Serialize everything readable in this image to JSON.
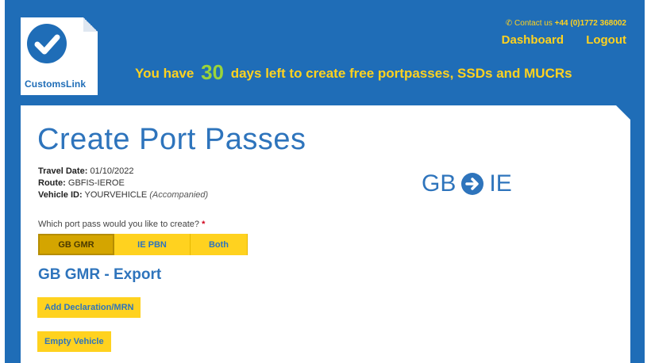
{
  "header": {
    "logo_text": "CustomsLink",
    "contact_prefix": "Contact us",
    "contact_phone": "+44 (0)1772 368002",
    "nav": {
      "dashboard": "Dashboard",
      "logout": "Logout"
    },
    "trial_before": "You have",
    "trial_days": "30",
    "trial_after": "days left to create free portpasses, SSDs and MUCRs"
  },
  "page": {
    "title": "Create Port Passes",
    "travel_date_label": "Travel Date:",
    "travel_date": "01/10/2022",
    "route_label": "Route:",
    "route": "GBFIS-IEROE",
    "vehicle_label": "Vehicle ID:",
    "vehicle_id": "YOURVEHICLE",
    "vehicle_type": "(Accompanied)",
    "route_from": "GB",
    "route_to": "IE",
    "question": "Which port pass would you like to create?",
    "required_mark": "*",
    "tabs": [
      "GB GMR",
      "IE PBN",
      "Both"
    ],
    "active_tab": "GB GMR",
    "section_title": "GB GMR - Export",
    "add_declaration": "Add Declaration/MRN",
    "empty_vehicle": "Empty Vehicle"
  },
  "colors": {
    "brand_blue": "#1f6db7",
    "accent_yellow": "#ffd21f",
    "days_green": "#9bd43a"
  },
  "icons": {
    "logo": "checkmark-icon",
    "contact": "phone-icon",
    "route": "arrow-right-circle-icon"
  }
}
